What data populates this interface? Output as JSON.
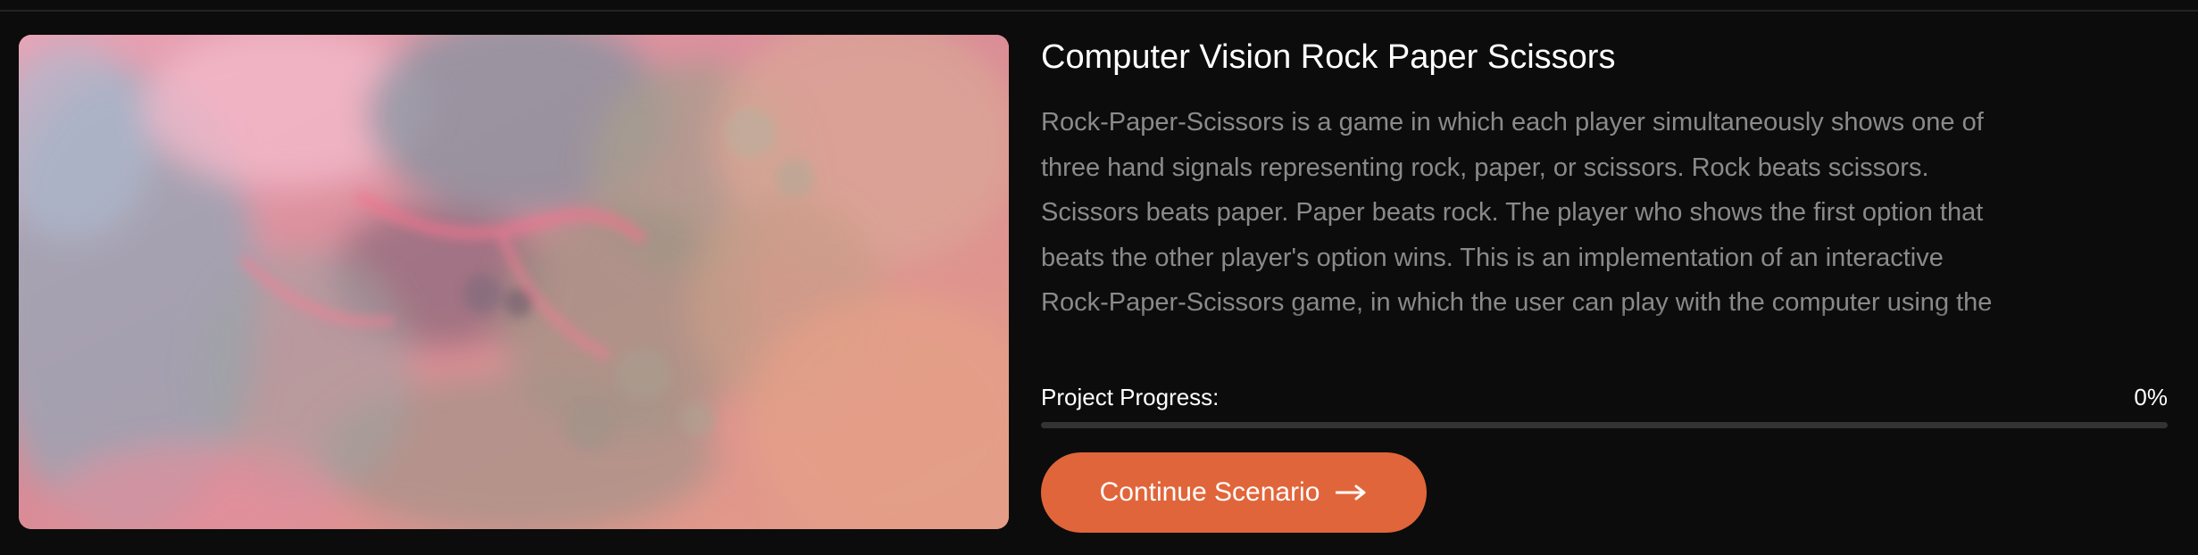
{
  "project": {
    "title": "Computer Vision Rock Paper Scissors",
    "description": "Rock-Paper-Scissors is a game in which each player simultaneously shows one of three hand signals representing rock, paper, or scissors. Rock beats scissors. Scissors beats paper. Paper beats rock. The player who shows the first option that beats the other player's option wins. This is an implementation of an interactive Rock-Paper-Scissors game, in which the user can play with the computer using the camera.",
    "thumbnail_icon": "abstract-fluid-art-image"
  },
  "progress": {
    "label": "Project Progress:",
    "value_text": "0%",
    "fraction": 0.0
  },
  "cta": {
    "label": "Continue Scenario",
    "icon": "arrow-right-icon"
  },
  "colors": {
    "background": "#0c0c0c",
    "accent": "#e1653a",
    "track": "#333333",
    "muted_text": "#8a8a8a"
  }
}
